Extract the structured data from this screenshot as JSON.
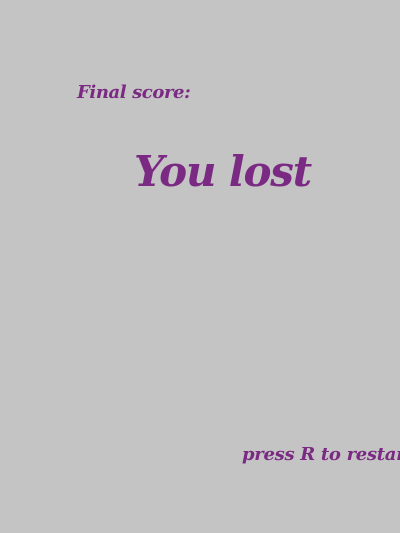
{
  "screen": {
    "background_color": "#c4c4c4",
    "text_color": "#7a2a82"
  },
  "score": {
    "label": "Final score:"
  },
  "result": {
    "title": "You lost"
  },
  "controls": {
    "restart_hint": "press R to restart"
  }
}
